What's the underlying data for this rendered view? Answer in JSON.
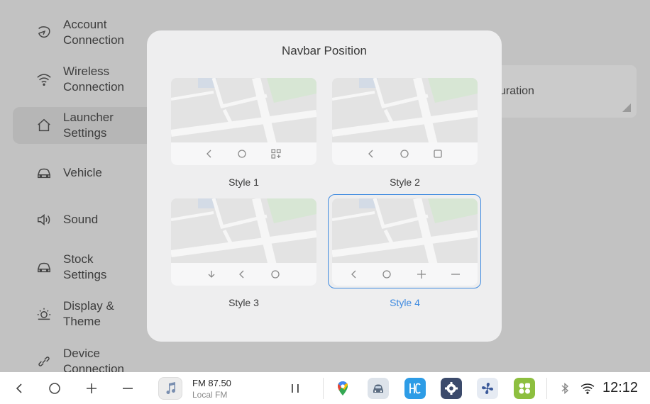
{
  "sidebar": {
    "items": [
      {
        "label": "Account\nConnection",
        "icon": "account-icon"
      },
      {
        "label": "Wireless\nConnection",
        "icon": "wifi-icon"
      },
      {
        "label": "Launcher\nSettings",
        "icon": "home-icon",
        "active": true
      },
      {
        "label": "Vehicle",
        "icon": "car-icon"
      },
      {
        "label": "Sound",
        "icon": "speaker-icon"
      },
      {
        "label": "Stock\nSettings",
        "icon": "car-icon"
      },
      {
        "label": "Display &\nTheme",
        "icon": "sun-icon"
      },
      {
        "label": "Device\nConnection",
        "icon": "link-icon"
      }
    ]
  },
  "background_card": {
    "text": "uration"
  },
  "dialog": {
    "title": "Navbar Position",
    "options": [
      {
        "label": "Style 1",
        "selected": false
      },
      {
        "label": "Style 2",
        "selected": false
      },
      {
        "label": "Style 3",
        "selected": false
      },
      {
        "label": "Style 4",
        "selected": true
      }
    ]
  },
  "taskbar": {
    "media": {
      "title": "FM 87.50",
      "subtitle": "Local FM"
    },
    "apps": [
      "maps-icon",
      "car-app-icon",
      "hc-app-icon",
      "settings-gear-icon",
      "fan-icon",
      "grid-app-icon"
    ],
    "time": "12:12"
  },
  "colors": {
    "accent": "#3e8ae0",
    "dialog_bg": "#eeeeef",
    "scrim": "#c2c2c2"
  }
}
